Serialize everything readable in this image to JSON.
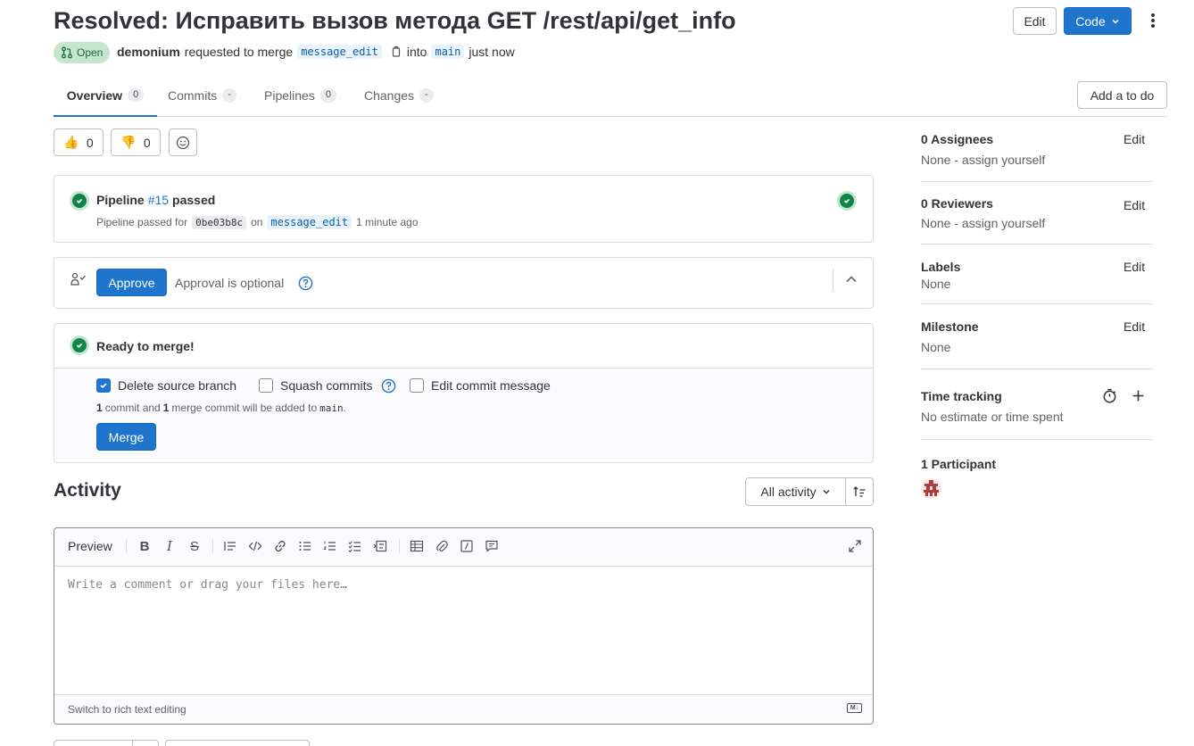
{
  "header": {
    "title": "Resolved: Исправить вызов метода GET /rest/api/get_info",
    "edit_label": "Edit",
    "code_label": "Code",
    "status": "Open",
    "author": "demonium",
    "requested_text": "requested to merge",
    "source_branch": "message_edit",
    "into_text": "into",
    "target_branch": "main",
    "time": "just now"
  },
  "tabs": [
    {
      "label": "Overview",
      "count": "0"
    },
    {
      "label": "Commits",
      "count": "-"
    },
    {
      "label": "Pipelines",
      "count": "0"
    },
    {
      "label": "Changes",
      "count": "-"
    }
  ],
  "todo_label": "Add a to do",
  "reactions": {
    "thumbsup": "👍",
    "thumbsup_count": "0",
    "thumbsdown": "👎",
    "thumbsdown_count": "0"
  },
  "pipeline": {
    "prefix": "Pipeline",
    "id": "#15",
    "status": "passed",
    "detail_prefix": "Pipeline passed for",
    "commit": "0be03b8c",
    "on_text": "on",
    "branch": "message_edit",
    "time": "1 minute ago"
  },
  "approval": {
    "button": "Approve",
    "text": "Approval is optional"
  },
  "merge": {
    "title": "Ready to merge!",
    "delete_branch": "Delete source branch",
    "squash": "Squash commits",
    "edit_message": "Edit commit message",
    "commit_count": "1",
    "commit_and": "commit and",
    "merge_count": "1",
    "merge_text": "merge commit will be added to",
    "target": "main",
    "period": ".",
    "button": "Merge"
  },
  "activity": {
    "title": "Activity",
    "filter": "All activity"
  },
  "editor": {
    "preview": "Preview",
    "placeholder": "Write a comment or drag your files here…",
    "switch_text": "Switch to rich text editing"
  },
  "sidebar": {
    "assignees": {
      "title": "0 Assignees",
      "edit": "Edit",
      "value": "None - assign yourself"
    },
    "reviewers": {
      "title": "0 Reviewers",
      "edit": "Edit",
      "value": "None - assign yourself"
    },
    "labels": {
      "title": "Labels",
      "edit": "Edit",
      "value": "None"
    },
    "milestone": {
      "title": "Milestone",
      "edit": "Edit",
      "value": "None"
    },
    "time_tracking": {
      "title": "Time tracking",
      "value": "No estimate or time spent"
    },
    "participants": {
      "title": "1 Participant"
    }
  },
  "colors": {
    "accent": "#1f75cb",
    "success": "#108548",
    "open_badge": "#c3e6cd"
  }
}
